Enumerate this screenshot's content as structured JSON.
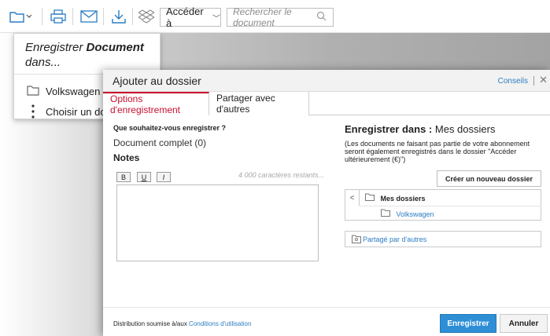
{
  "toolbar": {
    "folder_icon": "folder-icon",
    "print_icon": "printer-icon",
    "mail_icon": "mail-icon",
    "download_icon": "download-icon",
    "dropbox_icon": "dropbox-icon",
    "access_label": "Accéder à",
    "search_placeholder": "Rechercher le document"
  },
  "dropdown": {
    "title_prefix": "Enregistrer ",
    "title_bold": "Document",
    "title_suffix": " dans...",
    "items": [
      {
        "label": "Volkswagen",
        "icon": "folder-icon"
      },
      {
        "label": "Choisir un dossier",
        "icon": "more-vertical-icon"
      }
    ]
  },
  "modal": {
    "title": "Ajouter au dossier",
    "conseils": "Conseils",
    "close": "✕",
    "tabs": [
      "Options d'enregistrement",
      "Partager avec d'autres"
    ],
    "left": {
      "question": "Que souhaitez-vous enregistrer ?",
      "document": "Document complet (0)",
      "notes_label": "Notes",
      "format_buttons": [
        "B",
        "U",
        "I"
      ],
      "remaining": "4 000 caractères restants..."
    },
    "right": {
      "save_in_label": "Enregistrer dans :",
      "save_in_value": "Mes dossiers",
      "note": "(Les documents ne faisant pas partie de votre abonnement seront également enregistrés dans le dossier \"Accéder ultérieurement (€)\")",
      "create_folder": "Créer un nouveau dossier",
      "tree_root": "Mes dossiers",
      "tree_child": "Volkswagen",
      "shared": "Partagé par d'autres"
    },
    "footer": {
      "distribution_prefix": "Distribution soumise à/aux ",
      "distribution_link": "Conditions d'utilisation",
      "save_button": "Enregistrer",
      "cancel_button": "Annuler"
    }
  },
  "colors": {
    "accent_blue": "#2e8fd6",
    "tab_red": "#c8102e"
  }
}
